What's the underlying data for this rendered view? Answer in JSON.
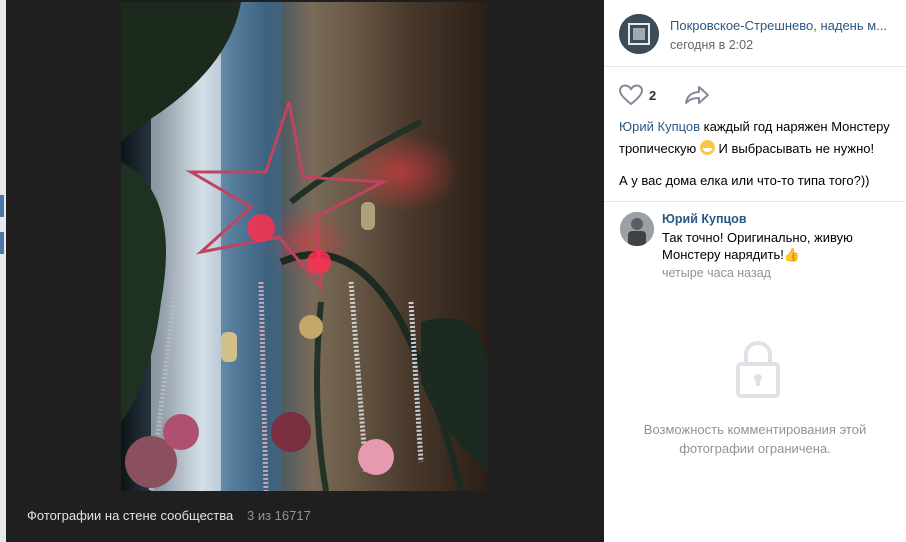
{
  "viewer": {
    "footer_title": "Фотографии на стене сообщества",
    "counter": "3 из 16717"
  },
  "post": {
    "group_name": "Покровское-Стрешнево, надень м...",
    "time": "сегодня в 2:02",
    "likes": "2",
    "author": "Юрий Купцов",
    "text_part1": " каждый год наряжен Монстеру тропическую ",
    "text_part2": " И выбрасывать не нужно!",
    "text_line2": "А у вас дома елка или что-то типа того?))"
  },
  "comment": {
    "author": "Юрий Купцов",
    "text": "Так точно! Оригинально, живую Монстеру нарядить!",
    "time": "четыре часа назад"
  },
  "restriction": {
    "text": "Возможность комментирования этой фотографии ограничена."
  },
  "icons": {
    "like": "heart-outline",
    "share": "arrow-share",
    "lock": "padlock"
  },
  "colors": {
    "link": "#2a5885",
    "muted": "#939393",
    "viewer_bg": "#1f1f1f"
  }
}
